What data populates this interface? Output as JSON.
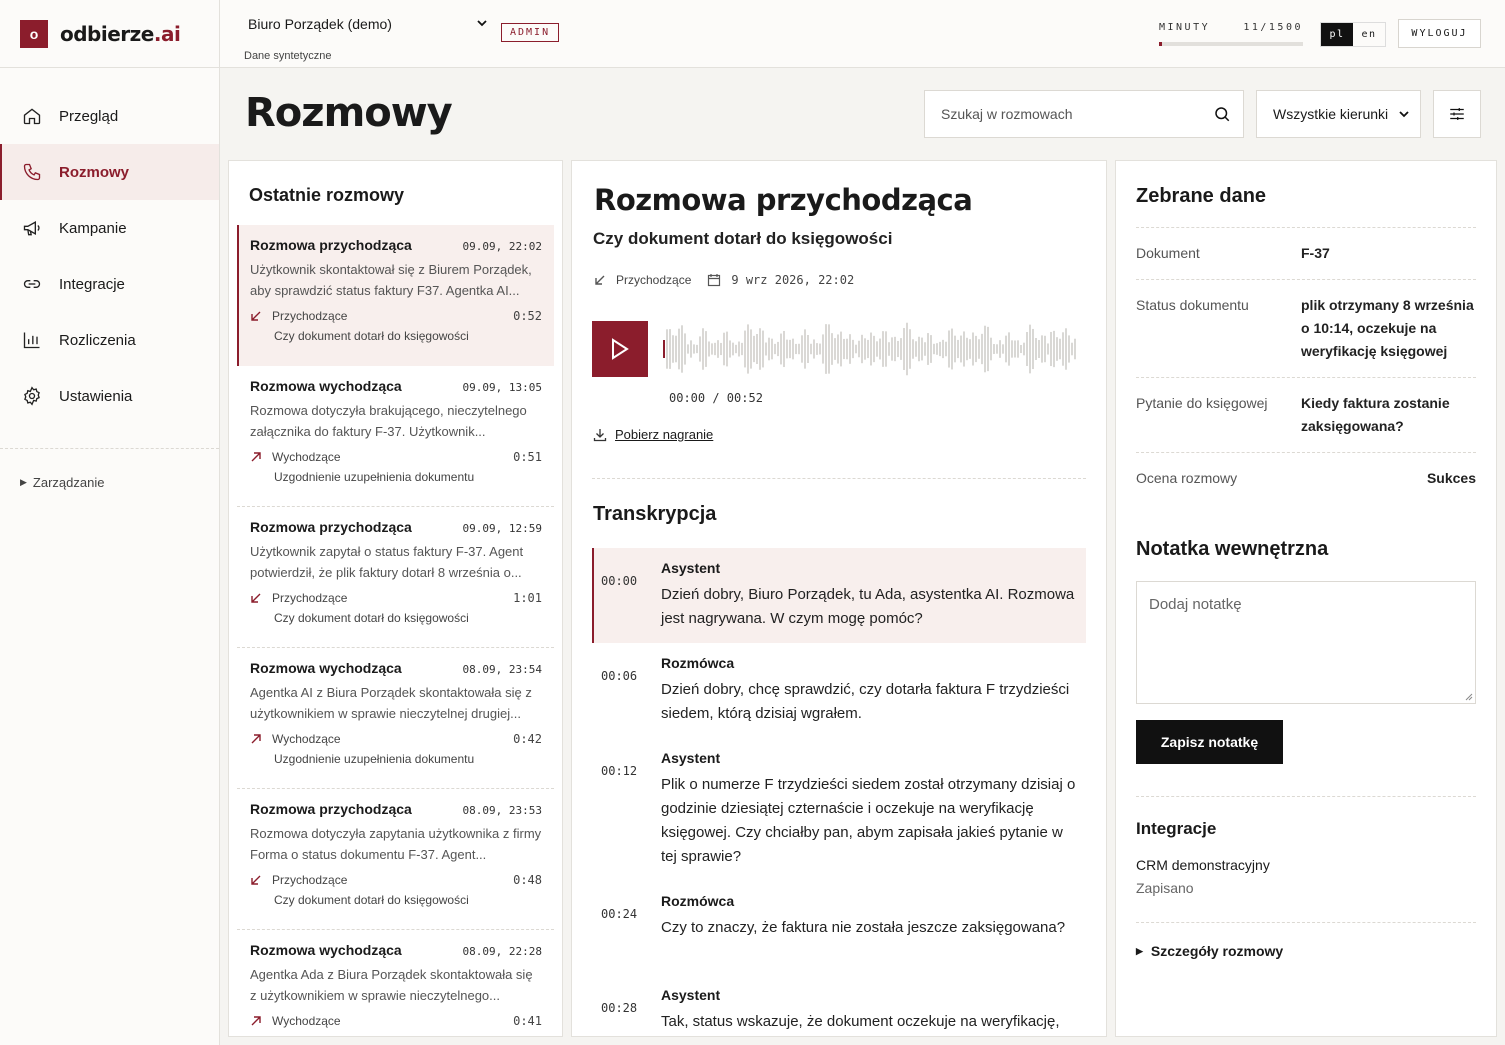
{
  "brand": {
    "mark": "o",
    "name": "odbierze",
    "suffix": ".ai"
  },
  "nav": {
    "items": [
      {
        "label": "Przegląd"
      },
      {
        "label": "Rozmowy"
      },
      {
        "label": "Kampanie"
      },
      {
        "label": "Integracje"
      },
      {
        "label": "Rozliczenia"
      },
      {
        "label": "Ustawienia"
      }
    ],
    "manage": "Zarządzanie"
  },
  "topbar": {
    "org": "Biuro Porządek (demo)",
    "org_sub": "Dane syntetyczne",
    "role": "ADMIN",
    "minutes_label": "MINUTY",
    "minutes_value": "11/1500",
    "minutes_used_fraction": 0.0073,
    "lang_pl": "pl",
    "lang_en": "en",
    "logout": "WYLOGUJ"
  },
  "page": {
    "title": "Rozmowy",
    "search_placeholder": "Szukaj w rozmowach",
    "direction_filter": "Wszystkie kierunki"
  },
  "list": {
    "title": "Ostatnie rozmowy",
    "calls": [
      {
        "title": "Rozmowa przychodząca",
        "time": "09.09, 22:02",
        "desc": "Użytkownik skontaktował się z Biurem Porządek, aby sprawdzić status faktury F37. Agentka AI...",
        "dir": "Przychodzące",
        "dur": "0:52",
        "topic": "Czy dokument dotarł do księgowości"
      },
      {
        "title": "Rozmowa wychodząca",
        "time": "09.09, 13:05",
        "desc": "Rozmowa dotyczyła brakującego, nieczytelnego załącznika do faktury F-37. Użytkownik...",
        "dir": "Wychodzące",
        "dur": "0:51",
        "topic": "Uzgodnienie uzupełnienia dokumentu"
      },
      {
        "title": "Rozmowa przychodząca",
        "time": "09.09, 12:59",
        "desc": "Użytkownik zapytał o status faktury F-37. Agent potwierdził, że plik faktury dotarł 8 września o...",
        "dir": "Przychodzące",
        "dur": "1:01",
        "topic": "Czy dokument dotarł do księgowości"
      },
      {
        "title": "Rozmowa wychodząca",
        "time": "08.09, 23:54",
        "desc": "Agentka AI z Biura Porządek skontaktowała się z użytkownikiem w sprawie nieczytelnej drugiej...",
        "dir": "Wychodzące",
        "dur": "0:42",
        "topic": "Uzgodnienie uzupełnienia dokumentu"
      },
      {
        "title": "Rozmowa przychodząca",
        "time": "08.09, 23:53",
        "desc": "Rozmowa dotyczyła zapytania użytkownika z firmy Forma o status dokumentu F-37. Agent...",
        "dir": "Przychodzące",
        "dur": "0:48",
        "topic": "Czy dokument dotarł do księgowości"
      },
      {
        "title": "Rozmowa wychodząca",
        "time": "08.09, 22:28",
        "desc": "Agentka Ada z Biura Porządek skontaktowała się z użytkownikiem w sprawie nieczytelnego...",
        "dir": "Wychodzące",
        "dur": "0:41",
        "topic": ""
      }
    ]
  },
  "detail": {
    "title": "Rozmowa przychodząca",
    "subtitle": "Czy dokument dotarł do księgowości",
    "direction": "Przychodzące",
    "datetime": "9 wrz 2026, 22:02",
    "player_time": "00:00 / 00:52",
    "download": "Pobierz nagranie",
    "transcript_title": "Transkrypcja",
    "transcript": [
      {
        "ts": "00:00",
        "speaker": "Asystent",
        "text": "Dzień dobry, Biuro Porządek, tu Ada, asystentka AI. Rozmowa jest nagrywana. W czym mogę pomóc?"
      },
      {
        "ts": "00:06",
        "speaker": "Rozmówca",
        "text": "Dzień dobry, chcę sprawdzić, czy dotarła faktura F trzydzieści siedem, którą dzisiaj wgrałem."
      },
      {
        "ts": "00:12",
        "speaker": "Asystent",
        "text": "Plik o numerze F trzydzieści siedem został otrzymany dzisiaj o godzinie dziesiątej czternaście i oczekuje na weryfikację księgowej. Czy chciałby pan, abym zapisała jakieś pytanie w tej sprawie?"
      },
      {
        "ts": "00:24",
        "speaker": "Rozmówca",
        "text": "Czy to znaczy, że faktura nie została jeszcze zaksięgowana?"
      },
      {
        "ts": "00:28",
        "speaker": "Asystent",
        "text": "Tak, status wskazuje, że dokument oczekuje na weryfikację,"
      }
    ]
  },
  "collected": {
    "title": "Zebrane dane",
    "rows": [
      {
        "key": "Dokument",
        "value": "F-37"
      },
      {
        "key": "Status dokumentu",
        "value": "plik otrzymany 8 września o 10:14, oczekuje na weryfikację księgowej"
      },
      {
        "key": "Pytanie do księgowej",
        "value": "Kiedy faktura zostanie zaksięgowana?"
      },
      {
        "key": "Ocena rozmowy",
        "value": "Sukces"
      }
    ],
    "note_title": "Notatka wewnętrzna",
    "note_placeholder": "Dodaj notatkę",
    "save_note": "Zapisz notatkę",
    "integrations_title": "Integracje",
    "integration_name": "CRM demonstracyjny",
    "integration_status": "Zapisano",
    "details_toggle": "Szczegóły rozmowy"
  },
  "colors": {
    "accent": "#8b1d2c",
    "active_bg": "#f8efed"
  }
}
